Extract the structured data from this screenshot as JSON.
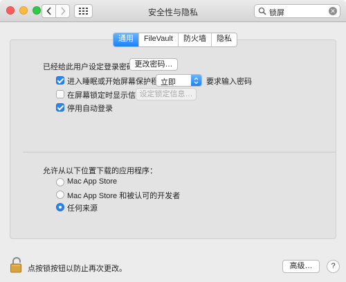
{
  "window": {
    "title": "安全性与隐私"
  },
  "search": {
    "value": "锁屏",
    "icon": "search-icon"
  },
  "tabs": [
    {
      "label": "通用",
      "active": true
    },
    {
      "label": "FileVault",
      "active": false
    },
    {
      "label": "防火墙",
      "active": false
    },
    {
      "label": "隐私",
      "active": false
    }
  ],
  "general": {
    "password_label": "已经给此用户设定登录密码",
    "change_password_button": "更改密码…",
    "require_password": {
      "label_before": "进入睡眠或开始屏幕保护程序",
      "checked": true,
      "select_value": "立即",
      "label_after": "要求输入密码"
    },
    "show_message": {
      "label": "在屏幕锁定时显示信息",
      "checked": false,
      "button": "设定锁定信息…"
    },
    "disable_auto_login": {
      "label": "停用自动登录",
      "checked": true
    }
  },
  "downloads": {
    "heading": "允许从以下位置下载的应用程序：",
    "options": [
      {
        "label": "Mac App Store",
        "selected": false
      },
      {
        "label": "Mac App Store 和被认可的开发者",
        "selected": false
      },
      {
        "label": "任何来源",
        "selected": true
      }
    ]
  },
  "footer": {
    "lock_text": "点按锁按钮以防止再次更改。",
    "advanced_button": "高级…"
  },
  "colors": {
    "accent": "#1a82fb",
    "lock": "#d9a440"
  }
}
